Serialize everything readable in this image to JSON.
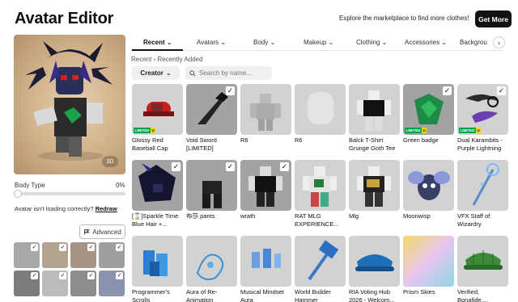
{
  "page": {
    "title": "Avatar Editor",
    "promo": "Explore the marketplace to find more clothes!",
    "get_more": "Get More"
  },
  "preview": {
    "badge": "3D"
  },
  "body_type": {
    "label": "Body Type",
    "value": "0%",
    "level": 0
  },
  "loading": {
    "question": "Avatar isn't loading correctly?",
    "redraw": "Redraw"
  },
  "advanced": {
    "label": "Advanced"
  },
  "tabs": [
    {
      "label": "Recent",
      "active": true
    },
    {
      "label": "Avatars",
      "active": false
    },
    {
      "label": "Body",
      "active": false
    },
    {
      "label": "Makeup",
      "active": false
    },
    {
      "label": "Clothing",
      "active": false
    },
    {
      "label": "Accessories",
      "active": false
    },
    {
      "label": "Backgrou",
      "active": false
    }
  ],
  "breadcrumb": {
    "root": "Recent",
    "sep": "›",
    "current": "Recently Added"
  },
  "filters": {
    "creator": "Creator",
    "search_placeholder": "Search by name..."
  },
  "items": [
    {
      "name": "Glossy Red Baseball Cap",
      "checked": false,
      "limited": true
    },
    {
      "name": "Void Sword [LIMITED]",
      "checked": true,
      "limited": false
    },
    {
      "name": "R6",
      "checked": false,
      "limited": false
    },
    {
      "name": "R6",
      "checked": false,
      "limited": false
    },
    {
      "name": "Balck T-Shirt Grunge Goth Tee",
      "checked": false,
      "limited": false
    },
    {
      "name": "Green badge",
      "checked": true,
      "limited": true
    },
    {
      "name": "Dual Karambits - Purple Lightning",
      "checked": true,
      "limited": true
    },
    {
      "name": "[⌛]Sparkle Time Blue Hair +...",
      "checked": true,
      "limited": false
    },
    {
      "name": "布莎 pants",
      "checked": true,
      "limited": false
    },
    {
      "name": "wrath",
      "checked": true,
      "limited": false
    },
    {
      "name": "RAT MLG EXPERIENCE...",
      "checked": false,
      "limited": false
    },
    {
      "name": "Mlg",
      "checked": false,
      "limited": false
    },
    {
      "name": "Moonwisp",
      "checked": false,
      "limited": false
    },
    {
      "name": "VFX Staff of Wizardry",
      "checked": false,
      "limited": false
    },
    {
      "name": "Programmer's Scrolls",
      "checked": false,
      "limited": false
    },
    {
      "name": "Aura of Re-Animation",
      "checked": false,
      "limited": false
    },
    {
      "name": "Musical Mindset Aura",
      "checked": false,
      "limited": false
    },
    {
      "name": "World Builder Hammer",
      "checked": false,
      "limited": false
    },
    {
      "name": "RIA Voting Hub 2026 - Welcom...",
      "checked": false,
      "limited": false
    },
    {
      "name": "Prism Skies",
      "checked": false,
      "limited": false
    },
    {
      "name": "Verified, Bonafide,...",
      "checked": false,
      "limited": false
    }
  ],
  "limited_badge": {
    "text": "LIMITED",
    "u": "U"
  },
  "check_glyph": "✓",
  "colors": {
    "accent": "#111111",
    "limited_green": "#00a24a",
    "limited_yellow": "#f7d417"
  }
}
